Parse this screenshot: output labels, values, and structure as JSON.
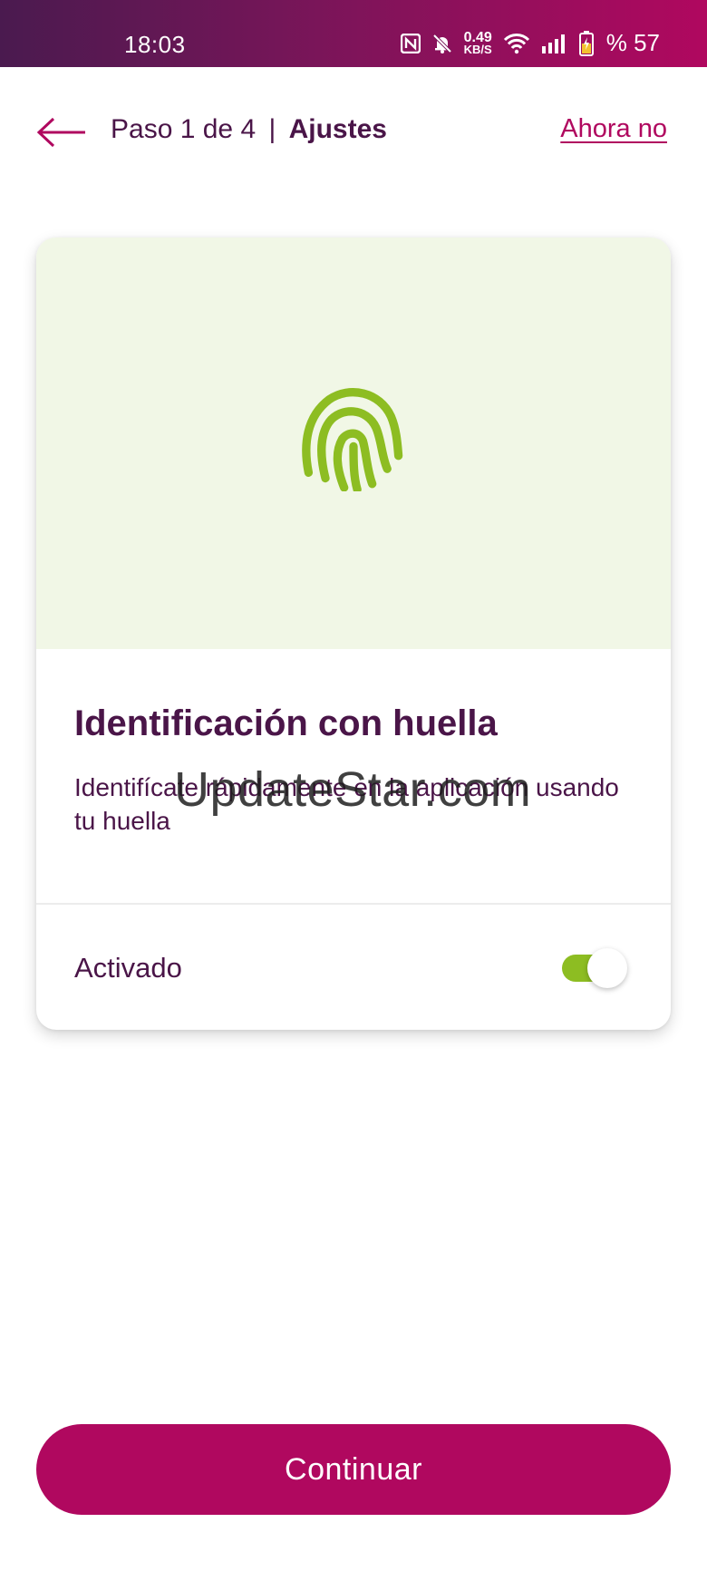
{
  "status_bar": {
    "time": "18:03",
    "net_speed_value": "0.49",
    "net_speed_unit": "KB/S",
    "battery_percent": "% 57"
  },
  "header": {
    "step": "Paso 1 de 4",
    "separator": "|",
    "section": "Ajustes",
    "skip_label": "Ahora no"
  },
  "card": {
    "title": "Identificación con huella",
    "description": "Identifícate rápidamente en la aplicación usando tu huella",
    "toggle_label": "Activado",
    "toggle_on": true
  },
  "watermark": "UpdateStar.com",
  "footer": {
    "continue_label": "Continuar"
  },
  "colors": {
    "brand": "#b0085f",
    "text": "#4a1548",
    "accent_green": "#8dbd22",
    "hero_bg": "#f1f7e6"
  },
  "icons": {
    "back": "arrow-left-icon",
    "fingerprint": "fingerprint-icon",
    "nfc": "nfc-icon",
    "mute": "bell-off-icon",
    "wifi": "wifi-icon",
    "signal": "signal-icon",
    "battery": "battery-charging-icon"
  }
}
